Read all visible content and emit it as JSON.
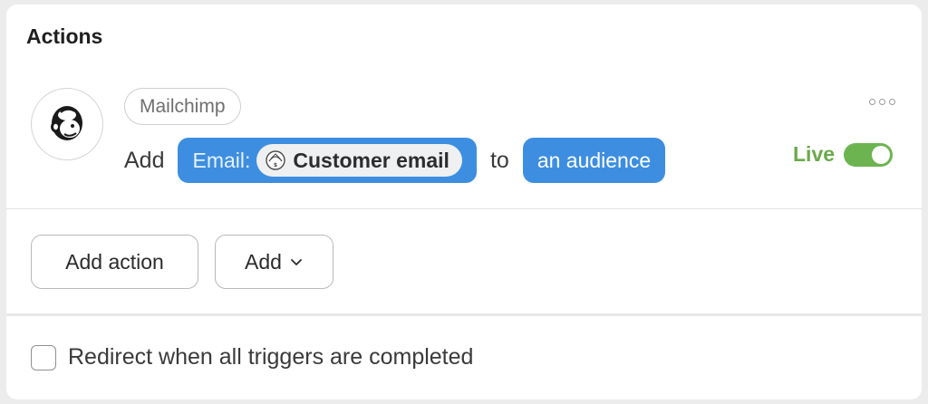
{
  "section": {
    "title": "Actions"
  },
  "action": {
    "app_name": "Mailchimp",
    "verb": "Add",
    "field_label": "Email:",
    "field_token": "Customer email",
    "connector": "to",
    "target": "an audience",
    "status_label": "Live",
    "status_on": true
  },
  "buttons": {
    "add_action": "Add action",
    "add_menu": "Add"
  },
  "options": {
    "redirect_label": "Redirect when all triggers are completed",
    "redirect_checked": false
  },
  "colors": {
    "pill_blue": "#3d8ee0",
    "live_green": "#6aaa4a",
    "toggle_green": "#6cb450"
  }
}
